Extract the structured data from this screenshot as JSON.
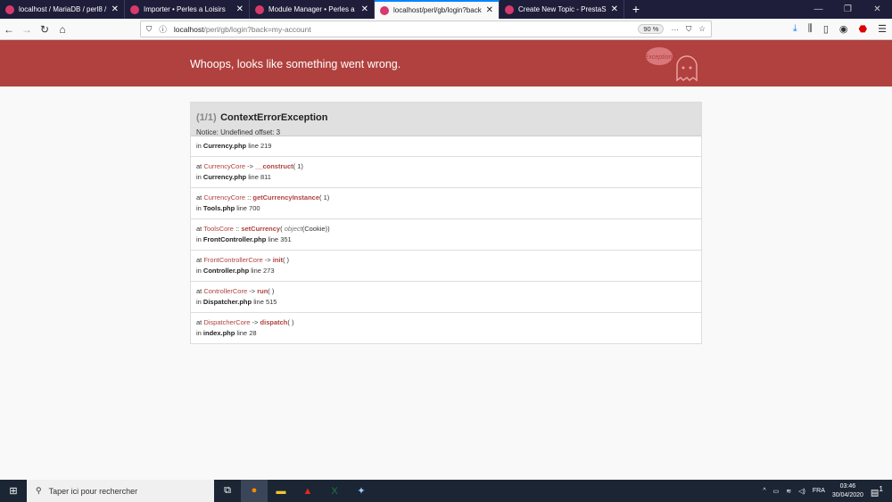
{
  "browser": {
    "tabs": [
      {
        "title": "localhost / MariaDB / perl8 / ps",
        "active": false,
        "favicon": "phpmyadmin-icon"
      },
      {
        "title": "Importer • Perles a Loisirs",
        "active": false,
        "favicon": "prestashop-icon"
      },
      {
        "title": "Module Manager • Perles a Loisirs",
        "active": false,
        "favicon": "prestashop-icon"
      },
      {
        "title": "localhost/perl/gb/login?back=my-account",
        "active": true,
        "favicon": "ghost-icon"
      },
      {
        "title": "Create New Topic - PrestaShop",
        "active": false,
        "favicon": "prestashop-forum-icon"
      }
    ],
    "url_host": "localhost",
    "url_path": "/perl/gb/login?back=my-account",
    "zoom": "90 %"
  },
  "error": {
    "banner": "Whoops, looks like something went wrong.",
    "ghost_text": "Exception!",
    "count": "(1/1)",
    "name": "ContextErrorException",
    "message": "Notice: Undefined offset: 3",
    "first": {
      "file": "Currency.php",
      "line": "219"
    },
    "trace": [
      {
        "cls": "CurrencyCore",
        "op": "->",
        "fn": "__construct",
        "args": "1",
        "file": "Currency.php",
        "line": "811"
      },
      {
        "cls": "CurrencyCore",
        "op": "::",
        "fn": "getCurrencyInstance",
        "args": "1",
        "file": "Tools.php",
        "line": "700"
      },
      {
        "cls": "ToolsCore",
        "op": "::",
        "fn": "setCurrency",
        "args": "object(Cookie)",
        "file": "FrontController.php",
        "line": "351"
      },
      {
        "cls": "FrontControllerCore",
        "op": "->",
        "fn": "init",
        "args": "",
        "file": "Controller.php",
        "line": "273"
      },
      {
        "cls": "ControllerCore",
        "op": "->",
        "fn": "run",
        "args": "",
        "file": "Dispatcher.php",
        "line": "515"
      },
      {
        "cls": "DispatcherCore",
        "op": "->",
        "fn": "dispatch",
        "args": "",
        "file": "index.php",
        "line": "28"
      }
    ]
  },
  "taskbar": {
    "search": "Taper ici pour rechercher",
    "lang": "FRA",
    "time": "03:46",
    "date": "30/04/2020",
    "notifications": "1"
  },
  "colors": {
    "banner": "#b0413e",
    "accent": "#0a84ff"
  }
}
